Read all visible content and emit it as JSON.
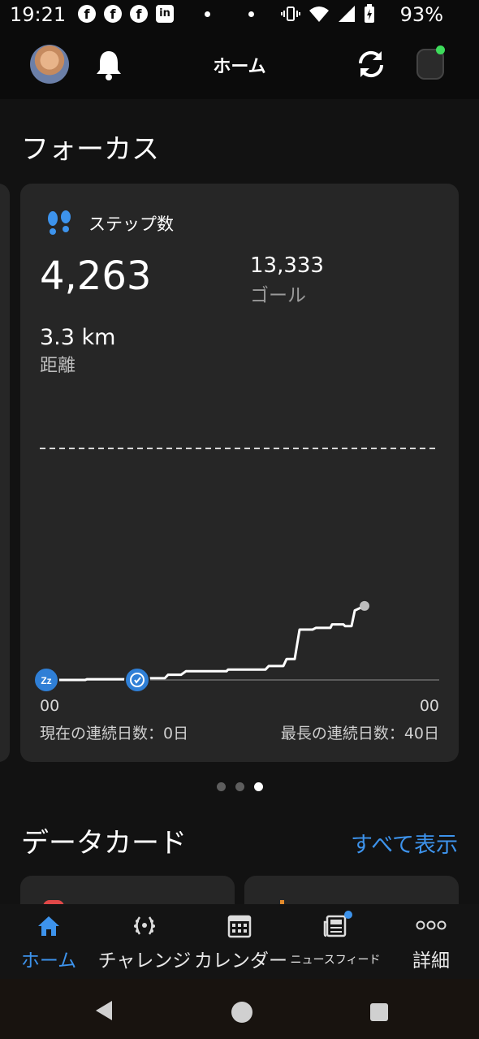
{
  "status_bar": {
    "time": "19:21",
    "app_icons": [
      "f",
      "f",
      "f",
      "in"
    ],
    "battery": "93%"
  },
  "header": {
    "title": "ホーム"
  },
  "focus": {
    "section_title": "フォーカス",
    "card": {
      "label": "ステップ数",
      "steps": "4,263",
      "goal_value": "13,333",
      "goal_label": "ゴール",
      "distance_value": "3.3 km",
      "distance_label": "距離",
      "x_start": "00",
      "x_end": "00",
      "current_streak": "現在の連続日数：0日",
      "longest_streak": "最長の連続日数：40日",
      "sleep_marker": "Zz"
    },
    "pager": {
      "count": 3,
      "active": 2
    }
  },
  "chart_data": {
    "type": "line",
    "title": "",
    "xlabel": "",
    "ylabel": "",
    "x_tick_labels": [
      "00",
      "00"
    ],
    "xlim": [
      0,
      24
    ],
    "ylim": [
      0,
      13333
    ],
    "goal_line": 13333,
    "series": [
      {
        "x": [
          0,
          2.4,
          2.5,
          5.4,
          5.5,
          7.3,
          7.5,
          8.3,
          8.6,
          11.1,
          11.2,
          13.5,
          13.7,
          14.6,
          14.8,
          15.3,
          15.6,
          16.4,
          16.6,
          17.5,
          17.6,
          18.3,
          18.4,
          18.8,
          19.0,
          19.6
        ],
        "y": [
          0,
          0,
          40,
          40,
          100,
          100,
          300,
          300,
          500,
          500,
          600,
          600,
          800,
          800,
          1200,
          1200,
          2900,
          2900,
          3000,
          3000,
          3200,
          3200,
          3100,
          3100,
          4000,
          4263
        ]
      }
    ],
    "markers": [
      {
        "kind": "sleep",
        "x": 0
      },
      {
        "kind": "wake",
        "x": 5.6
      }
    ],
    "end_point": {
      "x": 19.6,
      "y": 4263
    }
  },
  "data_cards": {
    "section_title": "データカード",
    "see_all": "すべて表示"
  },
  "bottom_nav": {
    "items": [
      {
        "label": "ホーム",
        "icon": "home-icon"
      },
      {
        "label": "チャレンジ",
        "icon": "laurel-icon"
      },
      {
        "label": "カレンダー",
        "icon": "calendar-icon"
      },
      {
        "label": "ニュースフィード",
        "icon": "newsfeed-icon"
      },
      {
        "label": "詳細",
        "icon": "more-icon"
      }
    ],
    "active_index": 0
  },
  "colors": {
    "accent": "#3d93ec",
    "card_bg": "#262626",
    "page_bg": "#121212",
    "watch_status": "#3ddc5b"
  }
}
